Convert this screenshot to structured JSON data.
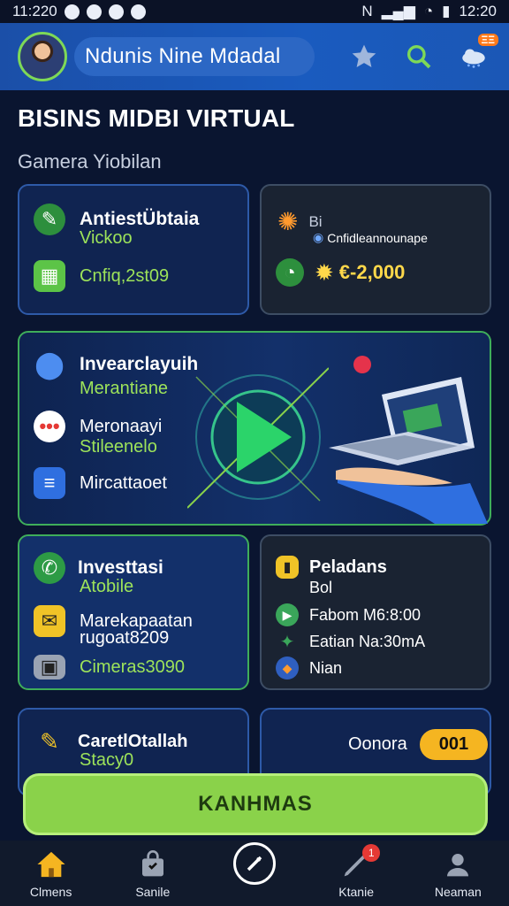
{
  "status": {
    "time_left": "11:220",
    "time_right": "12:20"
  },
  "header": {
    "user_name": "Ndunis Nine Mdadal"
  },
  "page": {
    "title": "BISINS MIDBI VIRTUAL",
    "subtitle": "Gamera Yiobilan"
  },
  "card1": {
    "title": "AntiestÜbtaia",
    "line1": "Vickoo",
    "line2": "Cnfiq,2st09"
  },
  "card2": {
    "line1": "Bi",
    "line2": "Cnfidleannounape",
    "amount": "€-2,000"
  },
  "card3": {
    "item1_title": "Invearclayuih",
    "item1_sub": "Merantiane",
    "item2_title": "Meronaayi",
    "item2_sub": "Stileenelo",
    "item3_title": "Mircattaoet"
  },
  "card4": {
    "title": "Investtasi",
    "line1": "Atobile",
    "line2a": "Marekapaatan",
    "line2b": "rugoat8209",
    "line3": "Cimeras3090"
  },
  "card5": {
    "title": "Peladans",
    "line1": "Bol",
    "line2": "Fabom M6:8:00",
    "line3": "Eatian Na:30mA",
    "line4": "Nian"
  },
  "card6": {
    "title": "CaretlOtallah",
    "sub": "Stacy0"
  },
  "card7": {
    "label": "Oonora",
    "pill": "001"
  },
  "cta": {
    "label": "KANHMAS"
  },
  "nav": {
    "items": [
      {
        "label": "Clmens"
      },
      {
        "label": "Sanile"
      },
      {
        "label": ""
      },
      {
        "label": "Ktanie"
      },
      {
        "label": "Neaman"
      }
    ],
    "badge": "1"
  },
  "colors": {
    "accent_green": "#8ad24a",
    "header_blue": "#1a5bbf",
    "amount_yellow": "#ffd84a"
  }
}
